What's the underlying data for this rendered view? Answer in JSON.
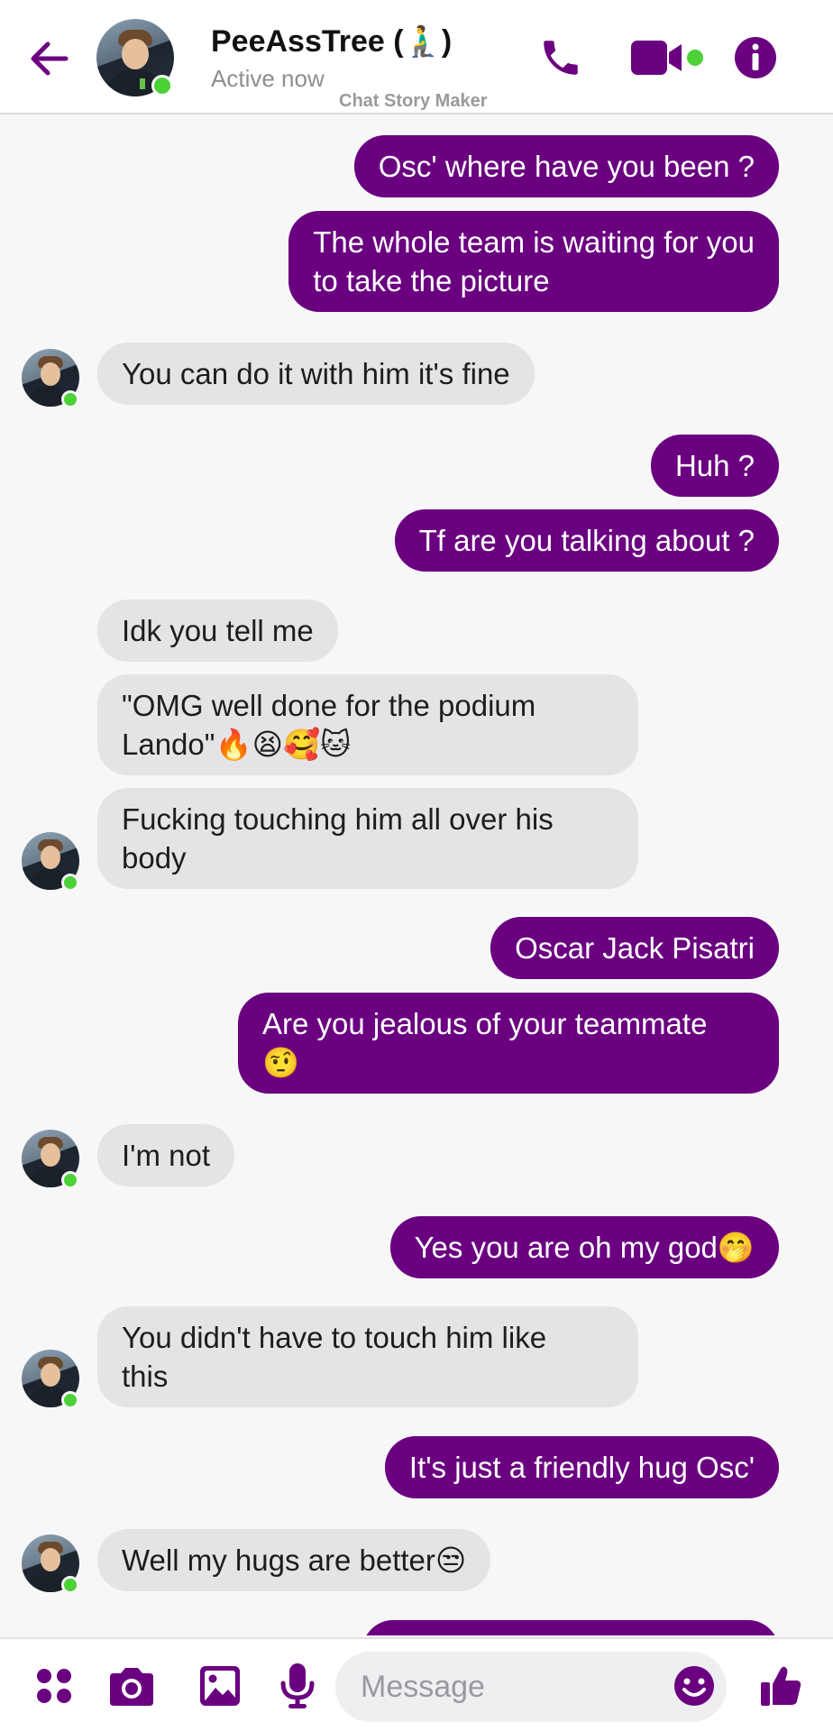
{
  "header": {
    "contact_name": "PeeAssTree (🧎‍♂️)",
    "status": "Active now",
    "watermark": "Chat Story Maker",
    "icons": [
      "back-arrow-icon",
      "phone-icon",
      "video-camera-icon",
      "info-icon"
    ]
  },
  "colors": {
    "accent": "#6a0080",
    "outgoing_bubble": "#6a0080",
    "incoming_bubble": "#e4e4e6",
    "online": "#4cd137"
  },
  "messages": [
    {
      "dir": "out",
      "text": "Osc' where have you been ?"
    },
    {
      "dir": "out",
      "text": "The whole team is waiting for you\nto take the picture"
    },
    {
      "dir": "in",
      "text": "You can do it with him it's fine"
    },
    {
      "dir": "out",
      "text": "Huh ?"
    },
    {
      "dir": "out",
      "text": "Tf are you talking about ?"
    },
    {
      "dir": "in",
      "text": "Idk you tell me"
    },
    {
      "dir": "in",
      "text": "\"OMG well done for the podium\nLando\"🔥😫🥰🐱"
    },
    {
      "dir": "in",
      "text": "Fucking touching him all over his\nbody"
    },
    {
      "dir": "out",
      "text": "Oscar Jack Pisatri"
    },
    {
      "dir": "out",
      "text": "Are you jealous of your teammate\n🤨"
    },
    {
      "dir": "in",
      "text": "I'm not"
    },
    {
      "dir": "out",
      "text": "Yes you are oh my god🤭"
    },
    {
      "dir": "in",
      "text": "You didn't have to touch him like\nthis"
    },
    {
      "dir": "out",
      "text": "It's just a friendly hug Osc'"
    },
    {
      "dir": "in",
      "text": "Well my hugs are better😒"
    },
    {
      "dir": "out",
      "text": ""
    }
  ],
  "composer": {
    "placeholder": "Message",
    "icons": [
      "apps-grid-icon",
      "camera-icon",
      "gallery-icon",
      "microphone-icon",
      "emoji-icon",
      "thumbs-up-icon"
    ]
  }
}
